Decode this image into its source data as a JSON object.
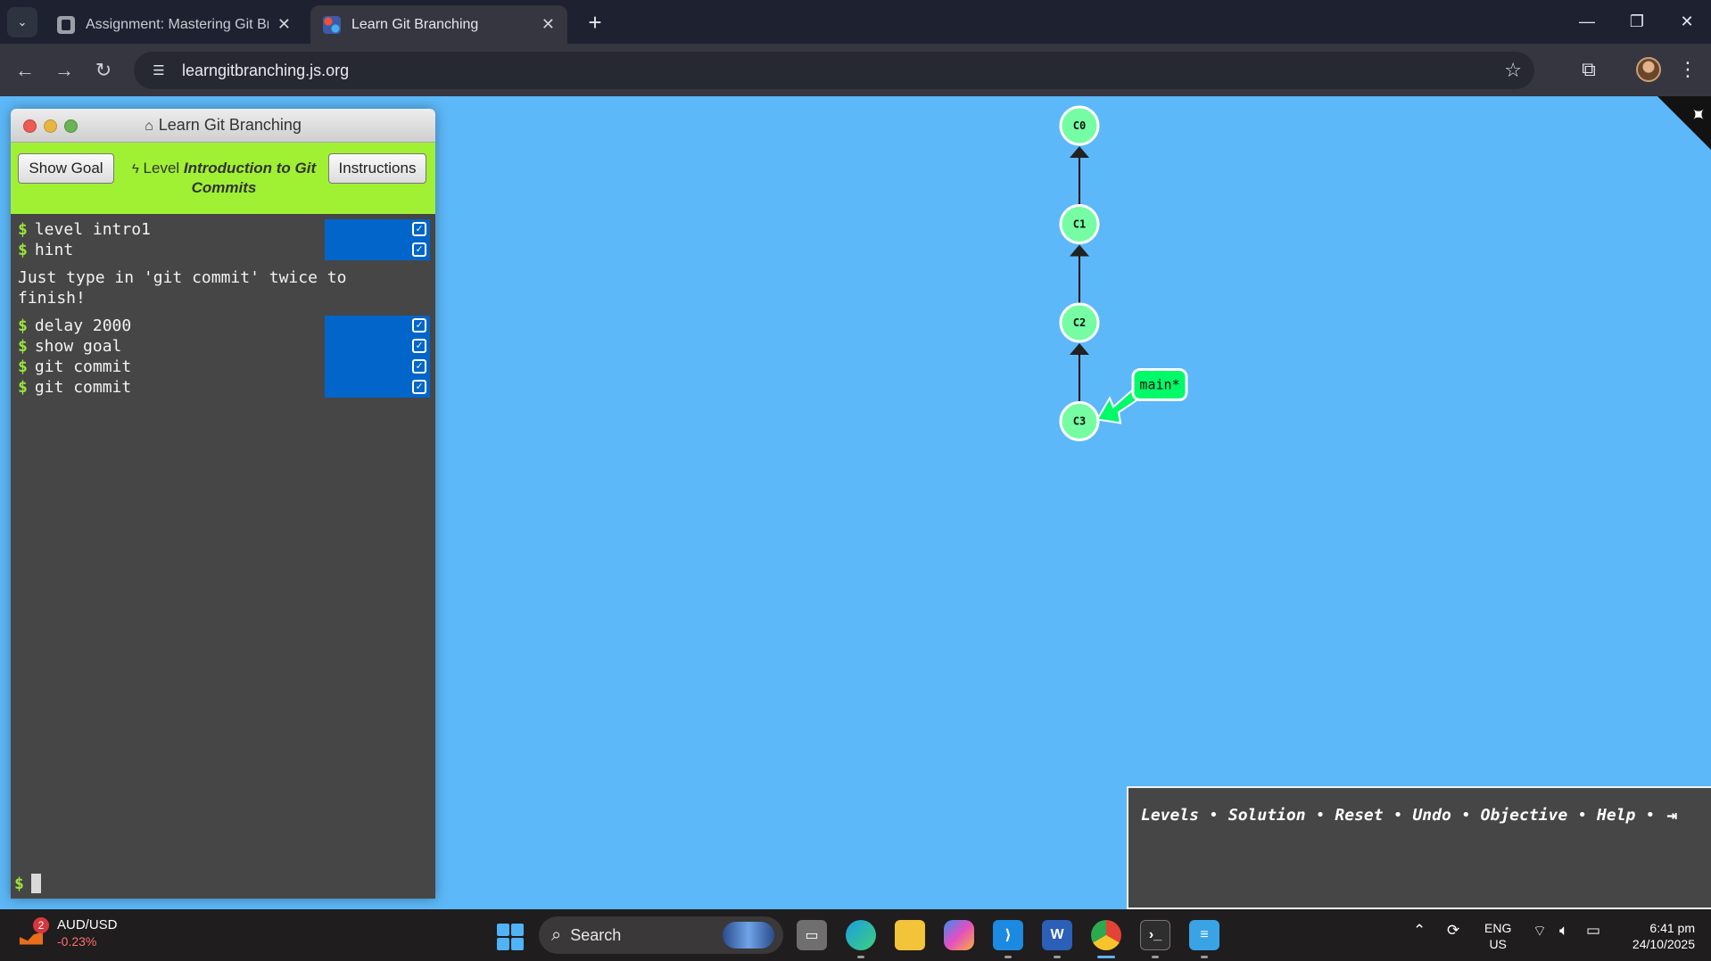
{
  "browser": {
    "tabs": [
      {
        "title": "Assignment: Mastering Git Bran",
        "active": false
      },
      {
        "title": "Learn Git Branching",
        "active": true
      }
    ],
    "url": "learngitbranching.js.org",
    "window_controls": {
      "minimize": "—",
      "restore": "❐",
      "close": "✕"
    }
  },
  "terminal": {
    "title": "Learn Git Branching",
    "show_goal_label": "Show Goal",
    "instructions_label": "Instructions",
    "level_prefix": "Level",
    "level_name": "Introduction to Git Commits",
    "prompt_symbol": "$",
    "commands_group1": [
      {
        "text": "level intro1",
        "done": true
      },
      {
        "text": "hint",
        "done": true
      }
    ],
    "message": "Just type in 'git commit' twice to\nfinish!",
    "commands_group2": [
      {
        "text": "delay 2000",
        "done": true
      },
      {
        "text": "show goal",
        "done": true
      },
      {
        "text": "git commit",
        "done": true
      },
      {
        "text": "git commit",
        "done": true
      }
    ]
  },
  "git_tree": {
    "commits": [
      "C0",
      "C1",
      "C2",
      "C3"
    ],
    "edges": [
      [
        "C1",
        "C0"
      ],
      [
        "C2",
        "C1"
      ],
      [
        "C3",
        "C2"
      ]
    ],
    "branches": [
      {
        "name": "main*",
        "target": "C3"
      }
    ],
    "colors": {
      "commit_fill": "#76fca3",
      "branch_fill": "#00fa68",
      "background": "#5cb8f8"
    }
  },
  "command_bar": {
    "links": [
      "Levels",
      "Solution",
      "Reset",
      "Undo",
      "Objective",
      "Help"
    ],
    "separator": "•"
  },
  "taskbar": {
    "ticker_symbol": "AUD/USD",
    "ticker_change": "-0.23%",
    "ticker_badge": "2",
    "search_label": "Search",
    "language": "ENG",
    "region": "US",
    "time": "6:41 pm",
    "date": "24/10/2025"
  }
}
